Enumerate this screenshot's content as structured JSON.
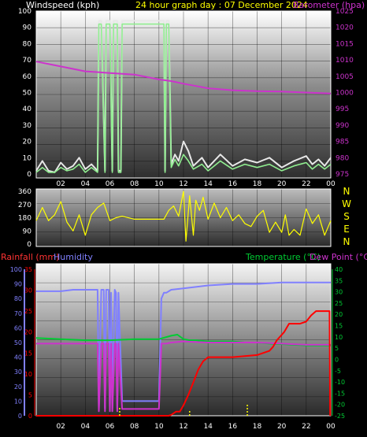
{
  "chart_data": [
    {
      "type": "line",
      "title": "24 hour graph day : 07 December 2024",
      "ylabel_left": "Windspeed (kph)",
      "ylabel_right": "Barometer (hpa)",
      "ylim_left": [
        0,
        100
      ],
      "ylim_right": [
        975,
        1025
      ],
      "left_ticks": [
        "0",
        "10",
        "20",
        "30",
        "40",
        "50",
        "60",
        "70",
        "80",
        "90",
        "100"
      ],
      "right_ticks": [
        "975",
        "980",
        "985",
        "990",
        "995",
        "1000",
        "1005",
        "1010",
        "1015",
        "1020",
        "1025"
      ],
      "x_ticks": [
        "02",
        "04",
        "06",
        "08",
        "10",
        "12",
        "14",
        "16",
        "18",
        "20",
        "22",
        "00"
      ],
      "colors": {
        "wind_gust": "#e8e8e8",
        "wind_avg": "#90ee90",
        "barometer": "#cc33cc",
        "title": "#ffff00"
      },
      "series": [
        {
          "name": "Barometer (hpa)",
          "axis": "right",
          "x": [
            0,
            2,
            4,
            6,
            8,
            10,
            11,
            12,
            13,
            14,
            16,
            18,
            20,
            22,
            24
          ],
          "y": [
            1009.5,
            1008,
            1006.5,
            1006,
            1005.5,
            1004,
            1003.5,
            1002.7,
            1002,
            1001.3,
            1000.7,
            1000.4,
            1000.3,
            1000,
            999.7
          ]
        },
        {
          "name": "Wind gust",
          "axis": "left",
          "x": [
            0,
            0.5,
            1,
            1.5,
            2,
            2.5,
            3,
            3.5,
            4,
            4.5,
            5,
            5.1,
            5.3,
            5.6,
            5.7,
            6,
            6.2,
            6.3,
            6.6,
            6.7,
            6.9,
            7,
            7.2,
            8,
            9,
            10.4,
            10.5,
            10.6,
            10.8,
            11,
            11.3,
            11.6,
            12,
            12.4,
            12.8,
            13.5,
            14,
            14.5,
            15,
            16,
            17,
            18,
            19,
            20,
            21,
            22,
            22.5,
            23,
            23.5,
            24
          ],
          "y": [
            2,
            8,
            2,
            1,
            7,
            3,
            5,
            10,
            3,
            6,
            2,
            94,
            94,
            2,
            94,
            94,
            2,
            94,
            94,
            2,
            2,
            94,
            94,
            94,
            94,
            94,
            2,
            94,
            94,
            6,
            12,
            8,
            20,
            14,
            5,
            10,
            4,
            8,
            12,
            5,
            9,
            7,
            10,
            4,
            8,
            11,
            6,
            9,
            5,
            10
          ]
        },
        {
          "name": "Wind average",
          "axis": "left",
          "x": [
            0,
            0.5,
            1,
            1.5,
            2,
            2.5,
            3,
            3.5,
            4,
            4.5,
            5,
            5.1,
            5.3,
            5.6,
            5.7,
            6,
            6.2,
            6.3,
            6.6,
            6.7,
            6.9,
            7,
            7.2,
            8,
            9,
            10.4,
            10.5,
            10.6,
            10.8,
            11,
            11.3,
            11.6,
            12,
            12.4,
            12.8,
            13.5,
            14,
            14.5,
            15,
            16,
            17,
            18,
            19,
            20,
            21,
            22,
            22.5,
            23,
            23.5,
            24
          ],
          "y": [
            1,
            4,
            1,
            1,
            4,
            2,
            3,
            6,
            1,
            4,
            1,
            92,
            92,
            1,
            92,
            92,
            1,
            92,
            92,
            1,
            1,
            92,
            92,
            92,
            92,
            92,
            1,
            92,
            92,
            4,
            9,
            5,
            12,
            8,
            3,
            6,
            2,
            5,
            8,
            3,
            6,
            4,
            6,
            2,
            5,
            7,
            3,
            6,
            3,
            6
          ]
        }
      ]
    },
    {
      "type": "line",
      "ylim": [
        0,
        360
      ],
      "left_ticks": [
        "0",
        "90",
        "180",
        "270",
        "360"
      ],
      "compass_labels": [
        "N",
        "W",
        "S",
        "E",
        "N"
      ],
      "x_ticks": [
        "02",
        "04",
        "06",
        "08",
        "10",
        "12",
        "14",
        "16",
        "18",
        "20",
        "22",
        "00"
      ],
      "colors": {
        "direction": "#ffff00",
        "compass": "#ffff00"
      },
      "series": [
        {
          "name": "Wind direction",
          "x": [
            0,
            0.5,
            1,
            1.5,
            2,
            2.5,
            3,
            3.5,
            4,
            4.5,
            5,
            5.5,
            6,
            6.5,
            7,
            8,
            9,
            10,
            10.4,
            10.8,
            11.2,
            11.6,
            12,
            12.2,
            12.5,
            12.8,
            13,
            13.3,
            13.6,
            14,
            14.5,
            15,
            15.5,
            16,
            16.5,
            17,
            17.5,
            18,
            18.5,
            19,
            19.5,
            20,
            20.3,
            20.6,
            21,
            21.5,
            22,
            22.5,
            23,
            23.5,
            24
          ],
          "y": [
            160,
            250,
            160,
            200,
            290,
            150,
            90,
            200,
            60,
            200,
            250,
            280,
            160,
            180,
            190,
            170,
            170,
            170,
            170,
            230,
            260,
            190,
            360,
            20,
            330,
            60,
            300,
            230,
            320,
            170,
            280,
            180,
            250,
            160,
            200,
            140,
            120,
            190,
            230,
            80,
            150,
            80,
            200,
            60,
            100,
            60,
            240,
            140,
            200,
            60,
            160
          ]
        }
      ]
    },
    {
      "type": "line",
      "ylabel_left": "Rainfall (mm)",
      "ylabel_left2": "Humidity",
      "ylabel_right": "Temperature (°C)",
      "ylabel_right2": "Dew Point (°C)",
      "ylim_rain": [
        0,
        35
      ],
      "ylim_humidity": [
        0,
        100
      ],
      "ylim_temp": [
        -25,
        40
      ],
      "rain_ticks": [
        "0",
        "5",
        "10",
        "15",
        "20",
        "25",
        "30",
        "35"
      ],
      "humidity_ticks": [
        "0",
        "10",
        "20",
        "30",
        "40",
        "50",
        "60",
        "70",
        "80",
        "90",
        "100"
      ],
      "temp_ticks": [
        "40",
        "35",
        "30",
        "25",
        "20",
        "15",
        "10",
        "5",
        "0",
        "-5",
        "-10",
        "-15",
        "-20",
        "-25"
      ],
      "x_ticks": [
        "02",
        "04",
        "06",
        "08",
        "10",
        "12",
        "14",
        "16",
        "18",
        "20",
        "22",
        "00"
      ],
      "colors": {
        "rainfall": "#ff0000",
        "humidity": "#8080ff",
        "temperature": "#00cc33",
        "dewpoint": "#cc33cc",
        "rain_rate": "#ffff00"
      },
      "series": [
        {
          "name": "Humidity",
          "axis": "humidity",
          "x": [
            0,
            1,
            2,
            3,
            4,
            4.8,
            5,
            5.1,
            5.3,
            5.5,
            5.6,
            5.7,
            5.9,
            6,
            6.1,
            6.2,
            6.4,
            6.5,
            6.6,
            6.7,
            7,
            8,
            9,
            10,
            10.2,
            10.4,
            10.6,
            11,
            12,
            14,
            16,
            18,
            20,
            22,
            24
          ],
          "y": [
            85,
            85,
            85,
            86,
            86,
            86,
            86,
            5,
            86,
            86,
            5,
            86,
            86,
            5,
            84,
            5,
            86,
            84,
            5,
            84,
            10,
            10,
            10,
            10,
            80,
            84,
            84,
            86,
            87,
            89,
            90,
            90,
            91,
            91,
            91
          ]
        },
        {
          "name": "Temperature (°C)",
          "axis": "temp",
          "x": [
            0,
            2,
            4,
            6,
            8,
            10,
            11,
            11.5,
            12,
            12.5,
            13,
            14,
            15,
            16,
            17,
            18,
            19,
            20,
            21,
            22,
            23,
            24
          ],
          "y": [
            9.5,
            9,
            8.5,
            8.5,
            9,
            9,
            10.5,
            11,
            9,
            8.5,
            8.5,
            8,
            8,
            8,
            7.5,
            7.5,
            7,
            6.8,
            6.5,
            6.2,
            6.2,
            6.2
          ]
        },
        {
          "name": "Dew Point (°C)",
          "axis": "temp",
          "x": [
            0,
            1,
            2,
            3,
            4,
            4.8,
            5,
            5.1,
            5.3,
            5.5,
            5.6,
            5.7,
            5.9,
            6,
            6.1,
            6.2,
            6.4,
            6.5,
            6.6,
            6.7,
            7,
            8,
            9,
            10,
            10.2,
            10.4,
            10.6,
            11,
            12,
            14,
            16,
            18,
            20,
            22,
            24
          ],
          "y": [
            7,
            7,
            7,
            7,
            7,
            7,
            7,
            -23,
            7,
            7,
            -23,
            7,
            7,
            -23,
            7,
            -23,
            7,
            7,
            -23,
            7,
            -22,
            -22,
            -22,
            -22,
            7,
            7,
            7,
            7.5,
            8,
            7.5,
            7.5,
            7.5,
            7,
            6.5,
            6.5
          ]
        },
        {
          "name": "Rainfall (mm)",
          "axis": "rain",
          "x": [
            0,
            2,
            4,
            6,
            8,
            10,
            10.8,
            11,
            11.4,
            11.7,
            12,
            12.4,
            12.8,
            13.2,
            13.6,
            14,
            16,
            18,
            19,
            19.3,
            19.6,
            19.9,
            20.2,
            20.6,
            21,
            21.5,
            22,
            22.4,
            22.8,
            23.4,
            23.6,
            23.9,
            23.95
          ],
          "y": [
            0,
            0,
            0,
            0,
            0,
            0,
            0,
            0.2,
            1,
            1,
            2.5,
            5,
            8,
            11,
            13,
            14,
            14,
            14.5,
            15.5,
            16.5,
            18,
            19,
            20,
            22,
            22,
            22,
            22.5,
            24,
            25,
            25,
            25,
            25,
            0
          ]
        },
        {
          "name": "Rain rate",
          "axis": "rain",
          "x": [
            6.8,
            12.5,
            17.2
          ],
          "y": [
            2,
            1.5,
            3
          ]
        }
      ]
    }
  ]
}
